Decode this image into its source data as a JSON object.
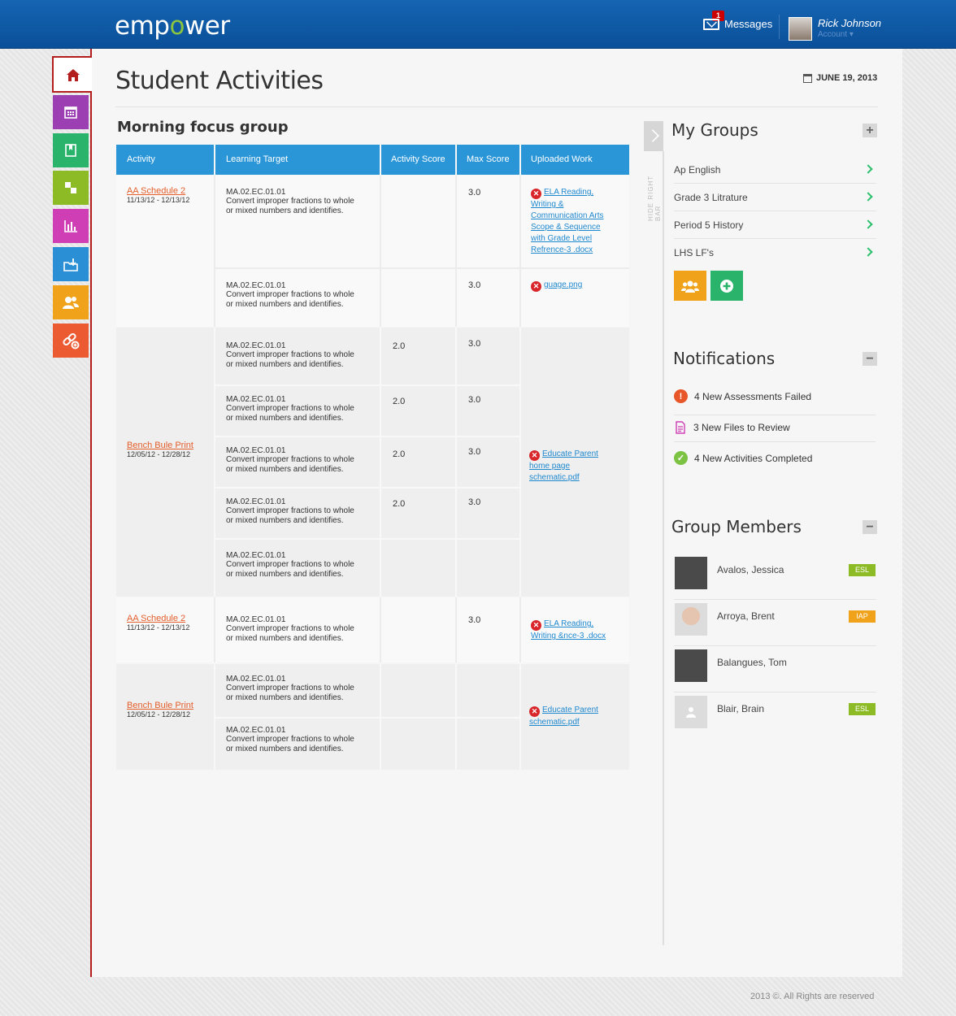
{
  "header": {
    "logo_prefix": "emp",
    "logo_mark": "o",
    "logo_suffix": "wer",
    "messages_label": "Messages",
    "messages_count": "1",
    "user_name": "Rick Johnson",
    "account_label": "Account"
  },
  "page": {
    "title": "Student Activities",
    "date": "JUNE 19, 2013",
    "group_title": "Morning focus group"
  },
  "nav": [
    {
      "icon": "home-icon"
    },
    {
      "icon": "calendar-icon",
      "color": "#9b3fb3"
    },
    {
      "icon": "book-icon",
      "color": "#2ab36b"
    },
    {
      "icon": "checker-icon",
      "color": "#8cbb26"
    },
    {
      "icon": "chart-icon",
      "color": "#cf3eb4"
    },
    {
      "icon": "folder-download-icon",
      "color": "#2b8fd5"
    },
    {
      "icon": "users-icon",
      "color": "#f0a21a"
    },
    {
      "icon": "link-add-icon",
      "color": "#ec5a32"
    }
  ],
  "table": {
    "headers": [
      "Activity",
      "Learning Target",
      "Activity Score",
      "Max Score",
      "Uploaded Work"
    ],
    "lt_code": "MA.02.EC.01.01",
    "lt_desc_1": "Convert improper fractions to whole",
    "lt_desc_2": "or mixed numbers and identifies.",
    "groups": [
      {
        "activity": "AA Schedule 2",
        "dates": "11/13/12  -  12/13/12",
        "rows": [
          {
            "score": "",
            "max": "3.0",
            "file": [
              "ELA Reading,",
              "Writing &",
              "Communication Arts",
              "Scope & Sequence",
              "with Grade Level",
              "Refrence-3 .docx"
            ]
          },
          {
            "score": "",
            "max": "3.0",
            "file": [
              "guage.png"
            ]
          }
        ]
      },
      {
        "activity": "Bench Bule Print",
        "dates": "12/05/12 - 12/28/12",
        "rows": [
          {
            "score": "2.0",
            "max": "3.0"
          },
          {
            "score": "2.0",
            "max": "3.0"
          },
          {
            "score": "2.0",
            "max": "3.0"
          },
          {
            "score": "2.0",
            "max": "3.0"
          },
          {
            "score": "",
            "max": ""
          }
        ],
        "file": [
          "Educate Parent",
          "home page",
          "schematic.pdf"
        ]
      },
      {
        "activity": "AA Schedule 2",
        "dates": "11/13/12  -  12/13/12",
        "rows": [
          {
            "score": "",
            "max": "3.0",
            "file": [
              "ELA Reading,",
              "Writing &nce-3 .docx"
            ]
          }
        ]
      },
      {
        "activity": "Bench Bule Print",
        "dates": "12/05/12 - 12/28/12",
        "rows": [
          {
            "score": "",
            "max": ""
          },
          {
            "score": "",
            "max": ""
          }
        ],
        "file": [
          "Educate Parent",
          "schematic.pdf"
        ]
      }
    ]
  },
  "sidebar": {
    "hide_label": "HIDE RIGHT BAR",
    "my_groups_title": "My Groups",
    "groups": [
      "Ap English",
      "Grade 3 Litrature",
      "Period 5 History",
      "LHS LF's"
    ],
    "notifications_title": "Notifications",
    "notifications": [
      {
        "text": "4 New Assessments Failed",
        "icon": "alert-icon",
        "color": "#e8572a"
      },
      {
        "text": "3 New Files to Review",
        "icon": "file-icon",
        "color": "#cf3eb4"
      },
      {
        "text": "4 New Activities Completed",
        "icon": "check-icon",
        "color": "#7cc243"
      }
    ],
    "members_title": "Group Members",
    "members": [
      {
        "name": "Avalos, Jessica",
        "tag": "ESL",
        "tag_color": "#8cbb26"
      },
      {
        "name": "Arroya, Brent",
        "tag": "IAP",
        "tag_color": "#f0a21a"
      },
      {
        "name": "Balangues, Tom",
        "tag": ""
      },
      {
        "name": "Blair, Brain",
        "tag": "ESL",
        "tag_color": "#8cbb26"
      }
    ]
  },
  "footer": "2013 ©. All Rights are reserved"
}
